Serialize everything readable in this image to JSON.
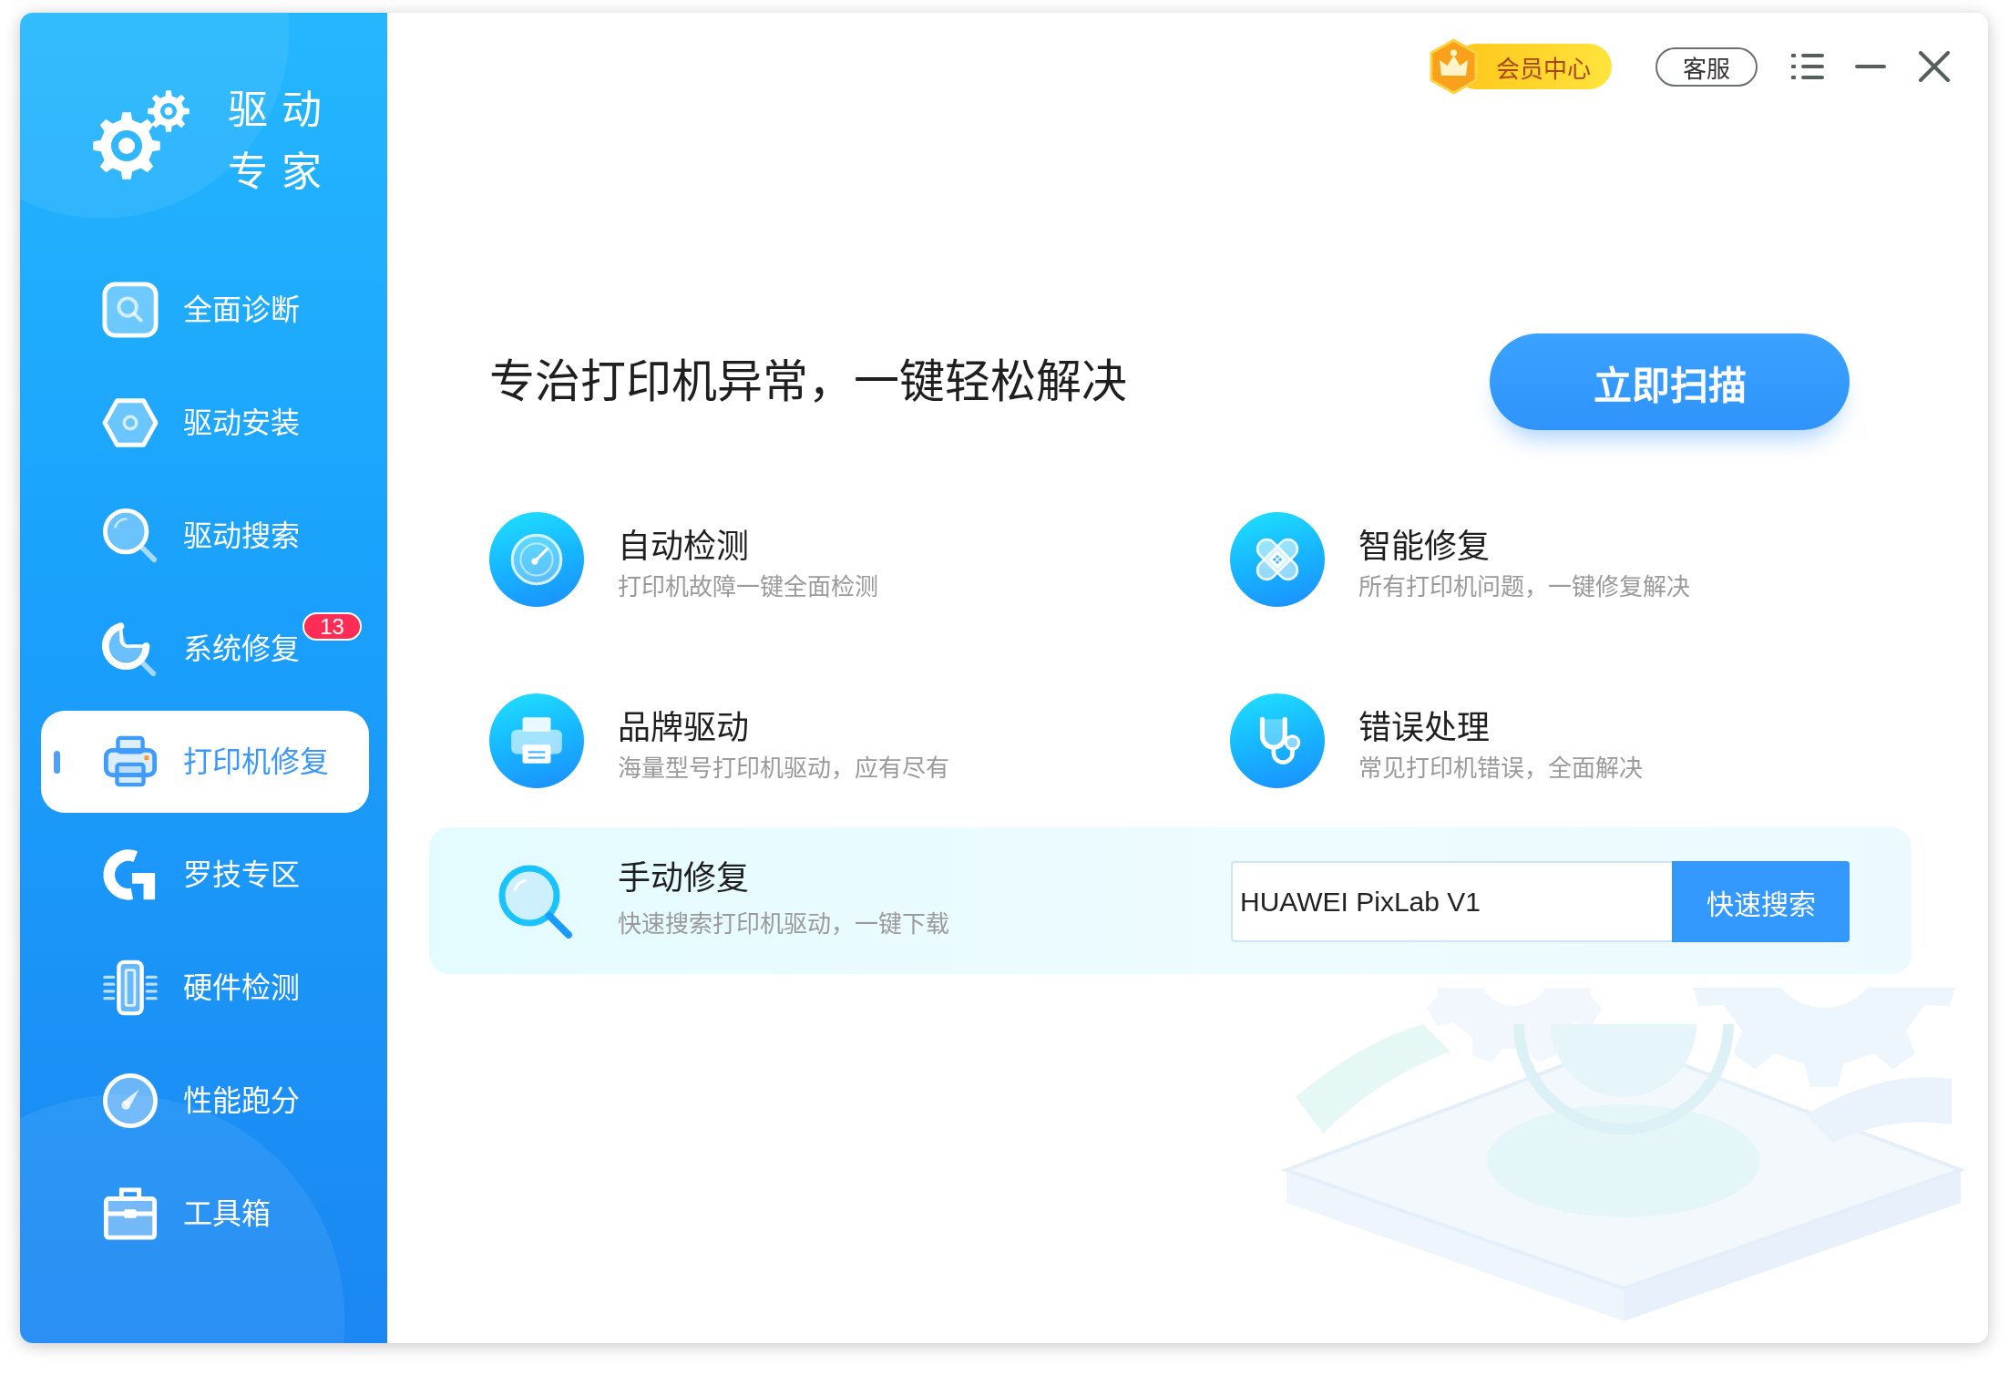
{
  "sidebar": {
    "logo_text": "驱动专家",
    "items": [
      {
        "label": "全面诊断",
        "selected": false
      },
      {
        "label": "驱动安装",
        "selected": false
      },
      {
        "label": "驱动搜索",
        "selected": false
      },
      {
        "label": "系统修复",
        "selected": false,
        "badge": "13"
      },
      {
        "label": "打印机修复",
        "selected": true
      },
      {
        "label": "罗技专区",
        "selected": false
      },
      {
        "label": "硬件检测",
        "selected": false
      },
      {
        "label": "性能跑分",
        "selected": false
      },
      {
        "label": "工具箱",
        "selected": false
      }
    ]
  },
  "top_bar": {
    "vip_button": "会员中心",
    "service_button": "客服"
  },
  "hero": {
    "headline": "专治打印机异常，一键轻松解决",
    "scan_button": "立即扫描"
  },
  "features": [
    {
      "title": "自动检测",
      "description": "打印机故障一键全面检测"
    },
    {
      "title": "智能修复",
      "description": "所有打印机问题，一键修复解决"
    },
    {
      "title": "品牌驱动",
      "description": "海量型号打印机驱动，应有尽有"
    },
    {
      "title": "错误处理",
      "description": "常见打印机错误，全面解决"
    }
  ],
  "manual_repair": {
    "title": "手动修复",
    "description": "快速搜索打印机驱动，一键下载",
    "search": {
      "value": "HUAWEI PixLab V1"
    },
    "search_button": "快速搜索"
  }
}
